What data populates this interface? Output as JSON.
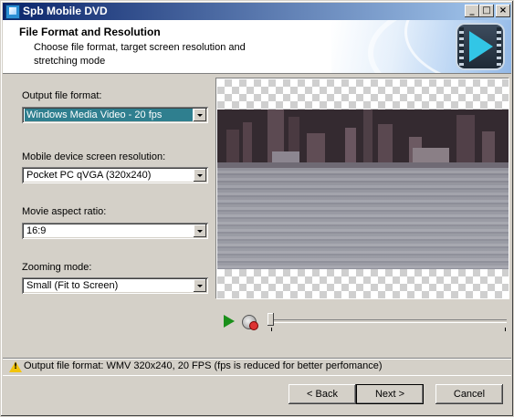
{
  "window": {
    "title": "Spb Mobile DVD",
    "controls": {
      "minimize": "_",
      "maximize": "□",
      "close": "×"
    }
  },
  "header": {
    "title": "File Format and Resolution",
    "description": "Choose file format, target screen resolution and stretching mode"
  },
  "form": {
    "output_format": {
      "label": "Output file format:",
      "value": "Windows Media Video - 20 fps"
    },
    "screen_resolution": {
      "label": "Mobile device screen resolution:",
      "value": "Pocket PC qVGA (320x240)"
    },
    "aspect_ratio": {
      "label": "Movie aspect ratio:",
      "value": "16:9"
    },
    "zooming_mode": {
      "label": "Zooming mode:",
      "value": "Small (Fit to Screen)"
    }
  },
  "player": {
    "position_fraction": 0.0
  },
  "status": {
    "message": "Output file format: WMV 320x240, 20 FPS (fps is reduced for better perfomance)"
  },
  "buttons": {
    "back": "< Back",
    "next": "Next >",
    "cancel": "Cancel"
  },
  "colors": {
    "accent": "#0a246a",
    "selection": "#2f7f8f",
    "play_icon": "#1a8f1a",
    "warning": "#f2c40a"
  }
}
